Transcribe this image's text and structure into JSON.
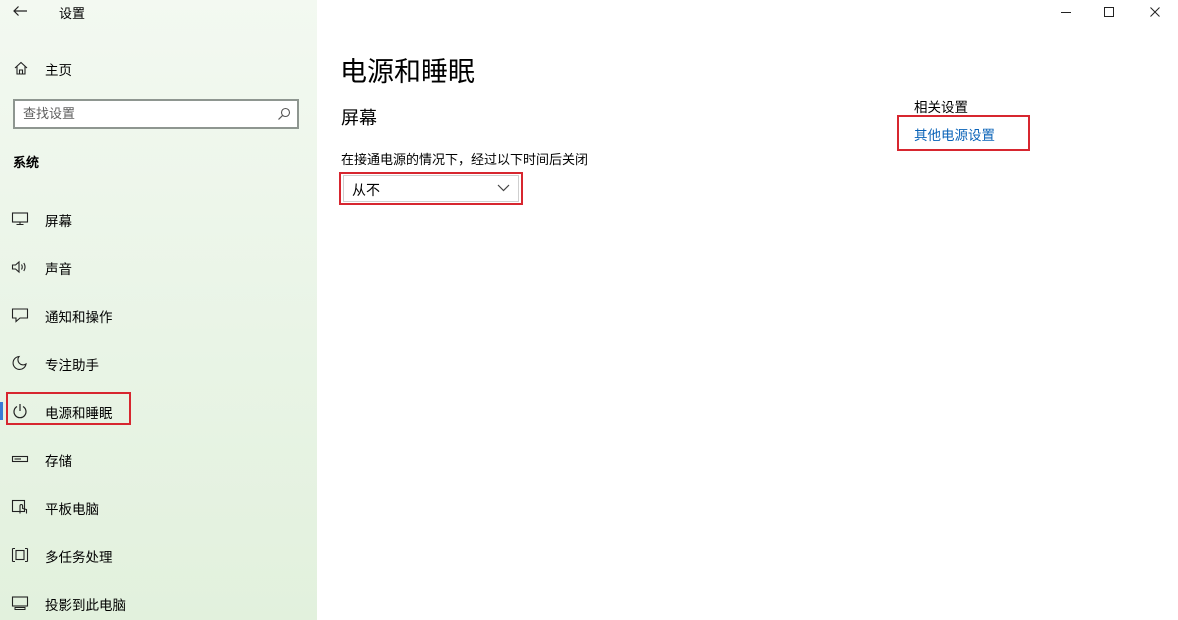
{
  "window": {
    "title": "设置",
    "controls": {
      "minimize": "minimize-icon",
      "maximize": "maximize-icon",
      "close": "close-icon"
    }
  },
  "sidebar": {
    "home_label": "主页",
    "search_placeholder": "查找设置",
    "section_title": "系统",
    "items": [
      {
        "label": "屏幕",
        "icon": "monitor-icon"
      },
      {
        "label": "声音",
        "icon": "speaker-icon"
      },
      {
        "label": "通知和操作",
        "icon": "notification-icon"
      },
      {
        "label": "专注助手",
        "icon": "moon-icon"
      },
      {
        "label": "电源和睡眠",
        "icon": "power-icon",
        "active": true
      },
      {
        "label": "存储",
        "icon": "storage-icon"
      },
      {
        "label": "平板电脑",
        "icon": "tablet-icon"
      },
      {
        "label": "多任务处理",
        "icon": "multitask-icon"
      },
      {
        "label": "投影到此电脑",
        "icon": "project-icon"
      }
    ]
  },
  "main": {
    "page_title": "电源和睡眠",
    "section_title": "屏幕",
    "screen_timeout_label": "在接通电源的情况下，经过以下时间后关闭",
    "screen_timeout_value": "从不"
  },
  "related": {
    "title": "相关设置",
    "link_label": "其他电源设置"
  },
  "colors": {
    "link": "#0a63b8",
    "highlight_box": "#d7262f",
    "sidebar_bg": "#e9f4e6"
  }
}
